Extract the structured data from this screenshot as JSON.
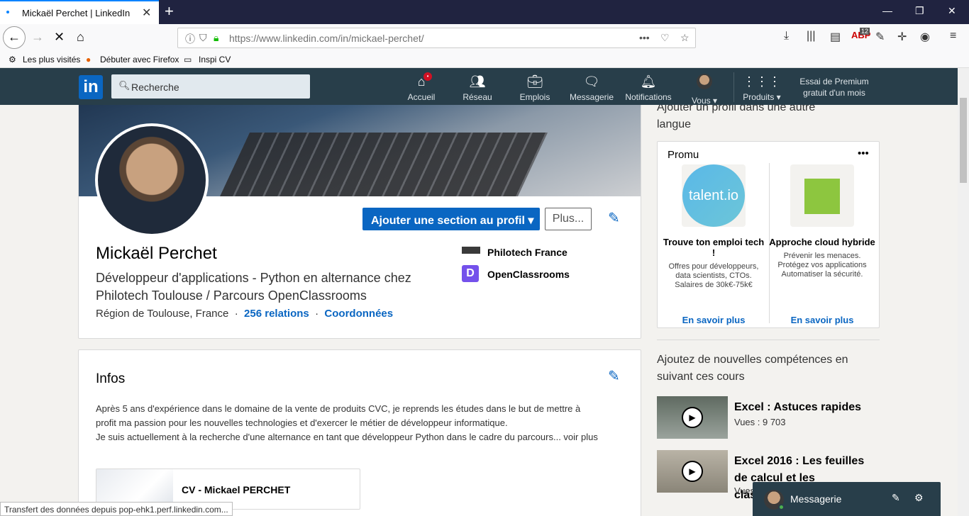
{
  "browser": {
    "tab_title": "Mickaël Perchet | LinkedIn",
    "url": "https://www.linkedin.com/in/mickael-perchet/",
    "bookmarks": [
      "Les plus visités",
      "Débuter avec Firefox",
      "Inspi CV"
    ],
    "adblock_count": "12",
    "status_text": "Transfert des données depuis pop-ehk1.perf.linkedin.com..."
  },
  "linkedin": {
    "logo": "in",
    "search_placeholder": "Recherche",
    "nav": [
      {
        "label": "Accueil",
        "icon": "home-icon"
      },
      {
        "label": "Réseau",
        "icon": "network-icon"
      },
      {
        "label": "Emplois",
        "icon": "jobs-icon"
      },
      {
        "label": "Messagerie",
        "icon": "messaging-icon"
      },
      {
        "label": "Notifications",
        "icon": "bell-icon"
      },
      {
        "label": "Vous ▾",
        "icon": "avatar"
      },
      {
        "label": "Produits ▾",
        "icon": "grid-icon"
      }
    ],
    "premium": "Essai de Premium gratuit d'un mois"
  },
  "profile": {
    "add_section": "Ajouter une section au profil",
    "more": "Plus...",
    "name": "Mickaël Perchet",
    "headline": "Développeur d'applications - Python en alternance chez Philotech Toulouse / Parcours OpenClassrooms",
    "location": "Région de Toulouse, France",
    "relations": "256 relations",
    "contact": "Coordonnées",
    "orgs": [
      {
        "name": "Philotech France"
      },
      {
        "name": "OpenClassrooms"
      }
    ]
  },
  "about": {
    "title": "Infos",
    "line1": "Après 5 ans d'expérience dans le domaine de la vente de produits CVC, je reprends les études dans le but de mettre à",
    "line2": "profit ma passion pour les nouvelles technologies et d'exercer le métier de développeur informatique.",
    "line3": "Je suis actuellement à la recherche d'une alternance en tant que développeur Python dans le cadre du parcours",
    "more": "... voir plus",
    "cv_title": "CV - Mickael PERCHET"
  },
  "sidebar": {
    "top_text": "Ajouter un profil dans une autre langue",
    "promo_title": "Promu",
    "ads": [
      {
        "brand": "talent.io",
        "title": "Trouve ton emploi tech !",
        "desc": "Offres pour développeurs, data scientists, CTOs. Salaires de 30k€-75k€",
        "link": "En savoir plus"
      },
      {
        "brand": "",
        "title": "Approche cloud hybride",
        "desc": "Prévenir les menaces. Protégez vos applications Automatiser la sécurité.",
        "link": "En savoir plus"
      }
    ],
    "courses_title": "Ajoutez de nouvelles compétences en suivant ces cours",
    "courses": [
      {
        "title": "Excel : Astuces rapides",
        "views": "Vues : 9 703"
      },
      {
        "title": "Excel 2016 : Les feuilles de calcul et les classeurs",
        "views": "Vues"
      }
    ]
  },
  "messaging": {
    "label": "Messagerie"
  },
  "colors": {
    "linkedin_blue": "#0a66c2",
    "header": "#283e4a",
    "tab_bar": "#202340"
  }
}
